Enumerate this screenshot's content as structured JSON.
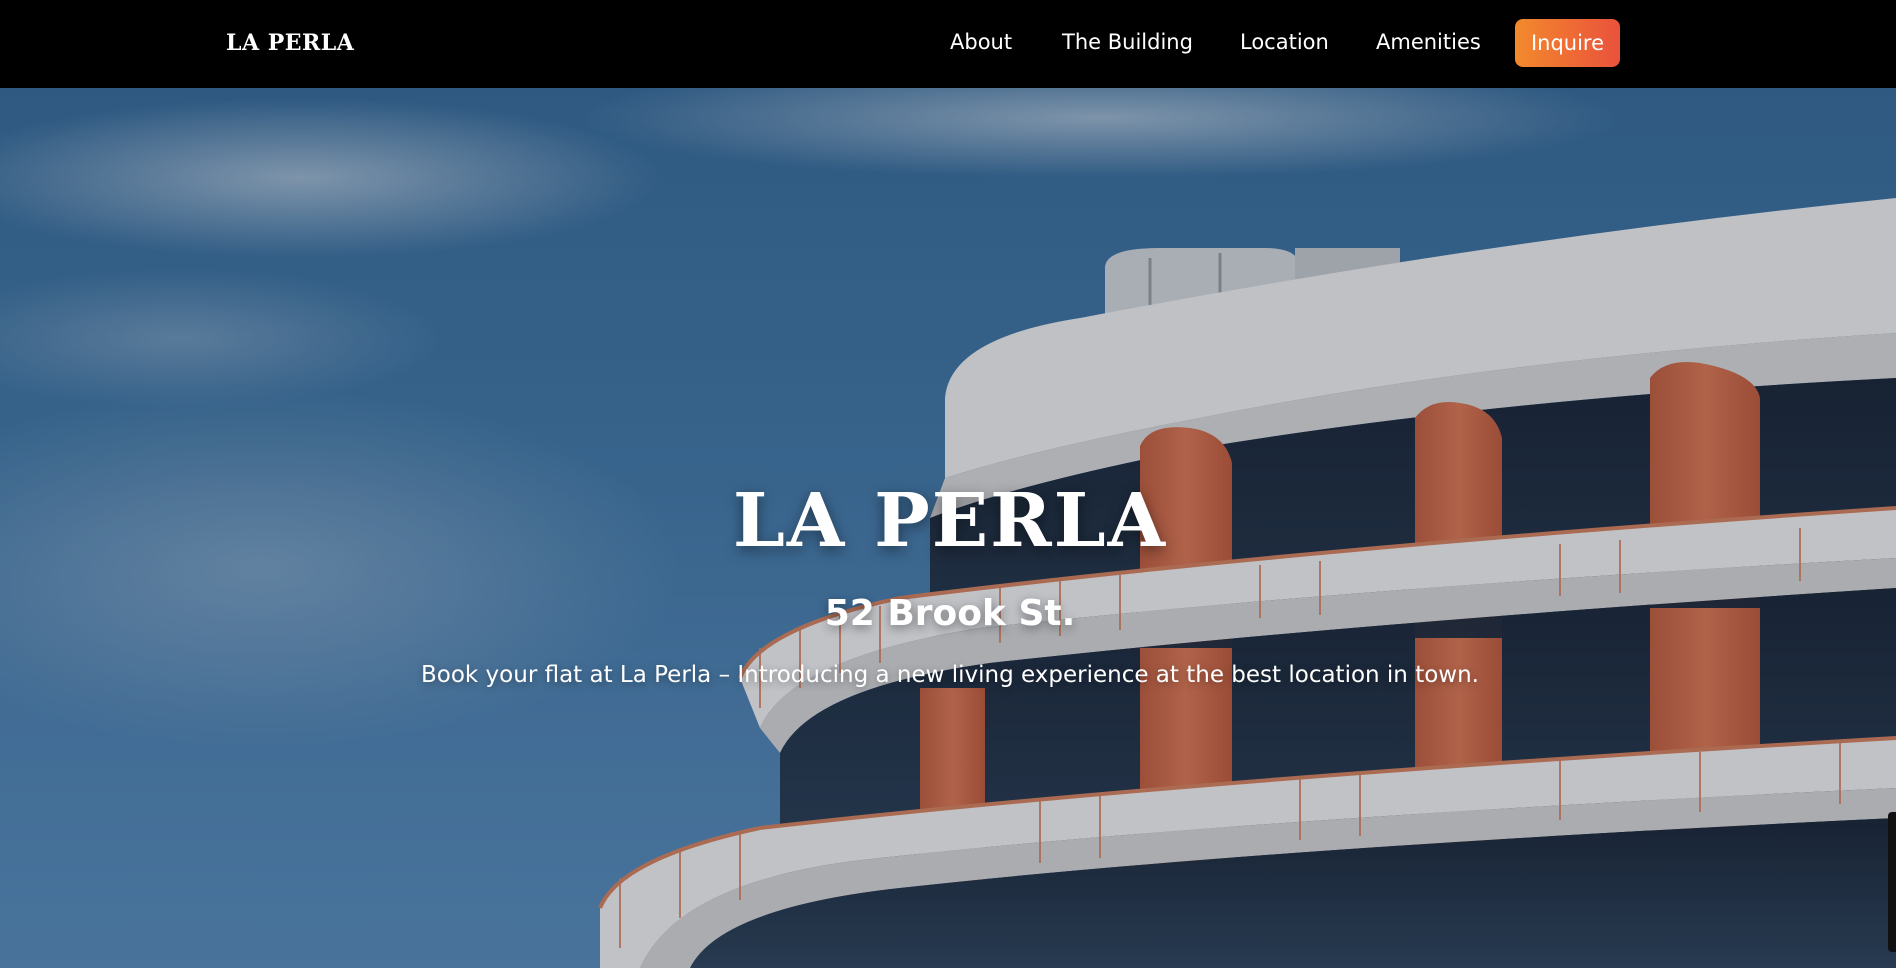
{
  "nav": {
    "brand": "LA PERLA",
    "links": [
      {
        "label": "About"
      },
      {
        "label": "The Building"
      },
      {
        "label": "Location"
      },
      {
        "label": "Amenities"
      }
    ],
    "cta_label": "Inquire"
  },
  "hero": {
    "title": "LA PERLA",
    "address": "52 Brook St.",
    "description": "Book your flat at La Perla – Introducing a new living experience at the best location in town."
  },
  "colors": {
    "nav_bg": "#000000",
    "cta_gradient_start": "#f28a2d",
    "cta_gradient_end": "#e9523c",
    "sky": "#447aa8",
    "building_accent": "#d9724f",
    "building_white": "#f1f1f1"
  }
}
